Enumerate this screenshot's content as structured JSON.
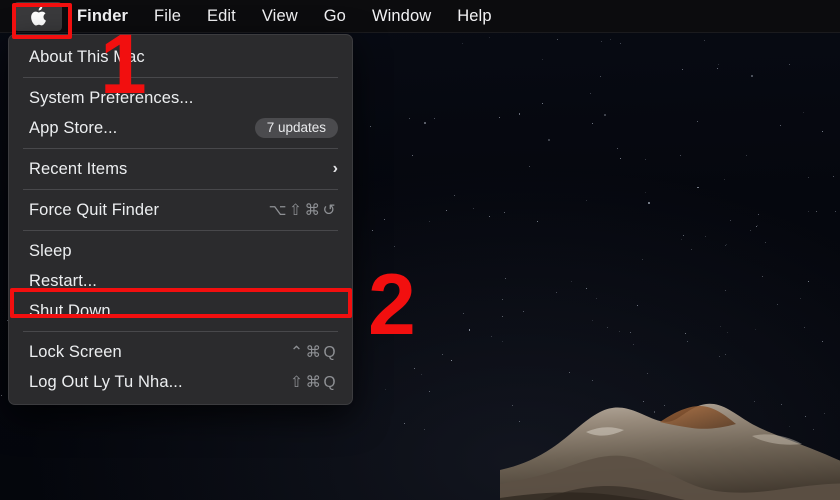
{
  "menubar": {
    "apple_icon": "apple-logo-icon",
    "items": [
      {
        "label": "Finder",
        "bold": true
      },
      {
        "label": "File",
        "bold": false
      },
      {
        "label": "Edit",
        "bold": false
      },
      {
        "label": "View",
        "bold": false
      },
      {
        "label": "Go",
        "bold": false
      },
      {
        "label": "Window",
        "bold": false
      },
      {
        "label": "Help",
        "bold": false
      }
    ]
  },
  "apple_menu": {
    "rows": [
      {
        "type": "item",
        "name": "about-this-mac",
        "label": "About This Mac",
        "shortcut": "",
        "badge": "",
        "chevron": ""
      },
      {
        "type": "separator",
        "name": "separator-1"
      },
      {
        "type": "item",
        "name": "system-preferences",
        "label": "System Preferences...",
        "shortcut": "",
        "badge": "",
        "chevron": ""
      },
      {
        "type": "item",
        "name": "app-store",
        "label": "App Store...",
        "shortcut": "",
        "badge": "7 updates",
        "chevron": ""
      },
      {
        "type": "separator",
        "name": "separator-2"
      },
      {
        "type": "item",
        "name": "recent-items",
        "label": "Recent Items",
        "shortcut": "",
        "badge": "",
        "chevron": "›"
      },
      {
        "type": "separator",
        "name": "separator-3"
      },
      {
        "type": "item",
        "name": "force-quit-finder",
        "label": "Force Quit Finder",
        "shortcut": "⌥⇧⌘↺",
        "badge": "",
        "chevron": ""
      },
      {
        "type": "separator",
        "name": "separator-4"
      },
      {
        "type": "item",
        "name": "sleep",
        "label": "Sleep",
        "shortcut": "",
        "badge": "",
        "chevron": ""
      },
      {
        "type": "item",
        "name": "restart",
        "label": "Restart...",
        "shortcut": "",
        "badge": "",
        "chevron": ""
      },
      {
        "type": "item",
        "name": "shut-down",
        "label": "Shut Down...",
        "shortcut": "",
        "badge": "",
        "chevron": ""
      },
      {
        "type": "separator",
        "name": "separator-5"
      },
      {
        "type": "item",
        "name": "lock-screen",
        "label": "Lock Screen",
        "shortcut": "⌃⌘Q",
        "badge": "",
        "chevron": ""
      },
      {
        "type": "item",
        "name": "log-out",
        "label": "Log Out Ly Tu Nha...",
        "shortcut": "⇧⌘Q",
        "badge": "",
        "chevron": ""
      }
    ]
  },
  "annotations": {
    "step_one": "1",
    "step_two": "2",
    "highlight_color": "#f20f0f",
    "targets": [
      "apple-menu-button",
      "restart-menu-item"
    ]
  },
  "desktop": {
    "wallpaper_description": "night-sky-mountain",
    "sky_color": "#05070d"
  }
}
